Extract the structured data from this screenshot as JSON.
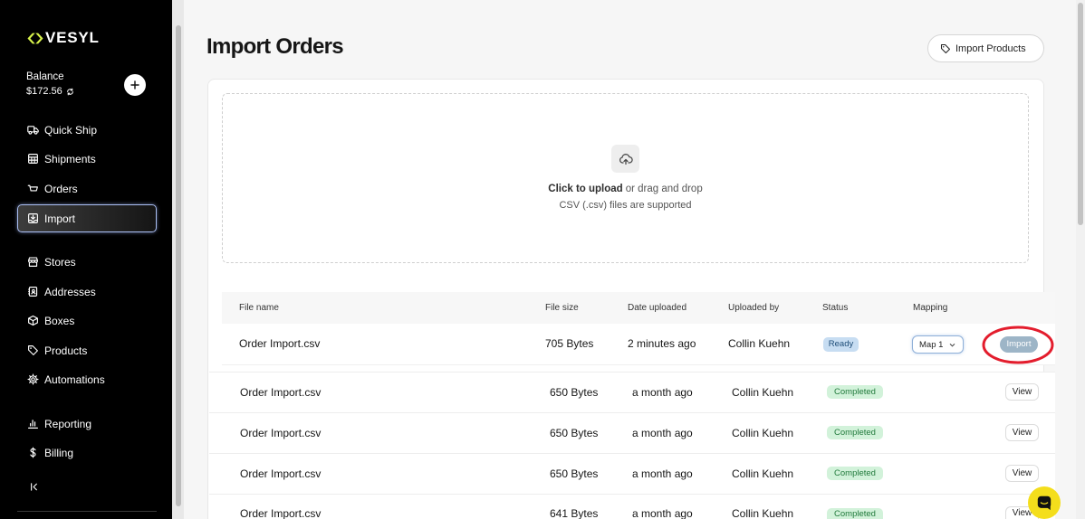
{
  "sidebar": {
    "logo_text": "VESYL",
    "logo_icon": "vesyl-logo-icon",
    "balance": {
      "label": "Balance",
      "value": "$172.56",
      "refresh_icon": "refresh-icon",
      "add_icon": "plus-icon"
    },
    "nav_items": [
      {
        "label": "Quick Ship",
        "icon": "truck-icon"
      },
      {
        "label": "Shipments",
        "icon": "table-icon"
      },
      {
        "label": "Orders",
        "icon": "cart-icon"
      },
      {
        "label": "Import",
        "icon": "import-icon",
        "active": true
      },
      {
        "label": "Stores",
        "icon": "store-icon"
      },
      {
        "label": "Addresses",
        "icon": "address-book-icon"
      },
      {
        "label": "Boxes",
        "icon": "box-icon"
      },
      {
        "label": "Products",
        "icon": "tag-icon"
      },
      {
        "label": "Automations",
        "icon": "gear-icon"
      },
      {
        "label": "Reporting",
        "icon": "bar-chart-icon"
      },
      {
        "label": "Billing",
        "icon": "dollar-icon"
      }
    ],
    "collapse_icon": "collapse-sidebar-icon"
  },
  "header": {
    "title": "Import Orders",
    "import_products_button": {
      "label": "Import Products",
      "icon": "tag-icon"
    }
  },
  "upload": {
    "icon": "cloud-upload-icon",
    "click_text": "Click to upload",
    "drag_text": "or drag and drop",
    "hint": "CSV (.csv) files are supported"
  },
  "table": {
    "columns": [
      "File name",
      "File size",
      "Date uploaded",
      "Uploaded by",
      "Status",
      "Mapping"
    ],
    "rows": [
      {
        "file_name": "Order Import.csv",
        "file_size": "705 Bytes",
        "date_uploaded": "2 minutes ago",
        "uploaded_by": "Collin Kuehn",
        "status": "Ready",
        "mapping": "Map 1",
        "action": "Import"
      },
      {
        "file_name": "Order Import.csv",
        "file_size": "650 Bytes",
        "date_uploaded": "a month ago",
        "uploaded_by": "Collin Kuehn",
        "status": "Completed",
        "mapping": "",
        "action": "View"
      },
      {
        "file_name": "Order Import.csv",
        "file_size": "650 Bytes",
        "date_uploaded": "a month ago",
        "uploaded_by": "Collin Kuehn",
        "status": "Completed",
        "mapping": "",
        "action": "View"
      },
      {
        "file_name": "Order Import.csv",
        "file_size": "650 Bytes",
        "date_uploaded": "a month ago",
        "uploaded_by": "Collin Kuehn",
        "status": "Completed",
        "mapping": "",
        "action": "View"
      },
      {
        "file_name": "Order Import.csv",
        "file_size": "641 Bytes",
        "date_uploaded": "a month ago",
        "uploaded_by": "Collin Kuehn",
        "status": "Completed",
        "mapping": "",
        "action": "View"
      }
    ]
  },
  "support_chat": {
    "icon": "chat-icon"
  },
  "colors": {
    "sidebar_bg": "#000000",
    "logo_accent": "#d8f34b",
    "page_bg": "#f6f6f6",
    "ready_badge_bg": "#c7ddf2",
    "completed_badge_bg": "#d2f2da",
    "import_button_bg": "#9db5c7",
    "highlight_annotation": "#e31d2d",
    "chat_button_bg": "#f4de1c"
  }
}
